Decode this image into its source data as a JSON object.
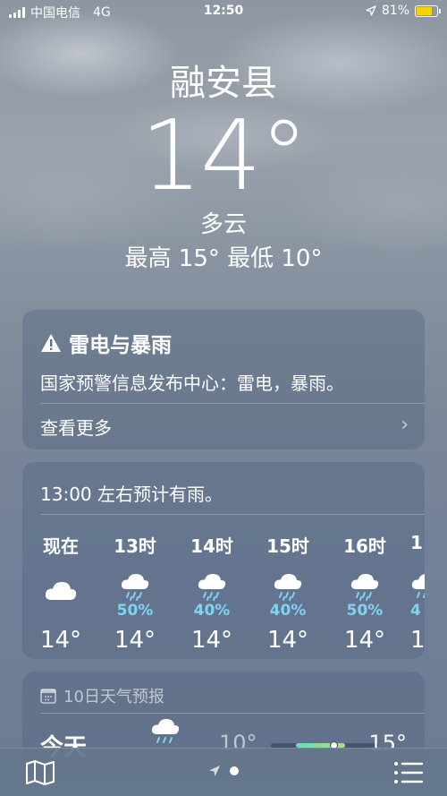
{
  "status_bar": {
    "carrier": "中国电信",
    "network": "4G",
    "time": "12:50",
    "battery": "81%",
    "battery_level": 0.81
  },
  "location": {
    "city": "融安县",
    "temperature": "14°",
    "condition": "多云",
    "high_low": "最高 15°  最低 10°"
  },
  "alert": {
    "title": "雷电与暴雨",
    "body": "国家预警信息发布中心：雷电，暴雨。",
    "more": "查看更多",
    "icon": "warning-icon"
  },
  "hourly": {
    "summary": "13:00 左右预计有雨。",
    "items": [
      {
        "label": "现在",
        "icon": "cloud-icon",
        "precip": "",
        "temp": "14°"
      },
      {
        "label": "13时",
        "icon": "rain-cloud-icon",
        "precip": "50%",
        "temp": "14°"
      },
      {
        "label": "14时",
        "icon": "rain-cloud-icon",
        "precip": "40%",
        "temp": "14°"
      },
      {
        "label": "15时",
        "icon": "rain-cloud-icon",
        "precip": "40%",
        "temp": "14°"
      },
      {
        "label": "16时",
        "icon": "rain-cloud-icon",
        "precip": "50%",
        "temp": "14°"
      },
      {
        "label": "1",
        "icon": "rain-cloud-icon",
        "precip": "4",
        "temp": "1"
      }
    ]
  },
  "ten_day": {
    "title": "10日天气预报",
    "row": {
      "day": "今天",
      "icon": "rain-cloud-icon",
      "low": "10°",
      "high": "15°"
    }
  },
  "bottom_bar": {
    "map_icon": "map-icon",
    "location_icon": "location-arrow-icon",
    "list_icon": "list-icon"
  },
  "colors": {
    "precip": "#7fd3f2",
    "battery": "#f5d400"
  }
}
